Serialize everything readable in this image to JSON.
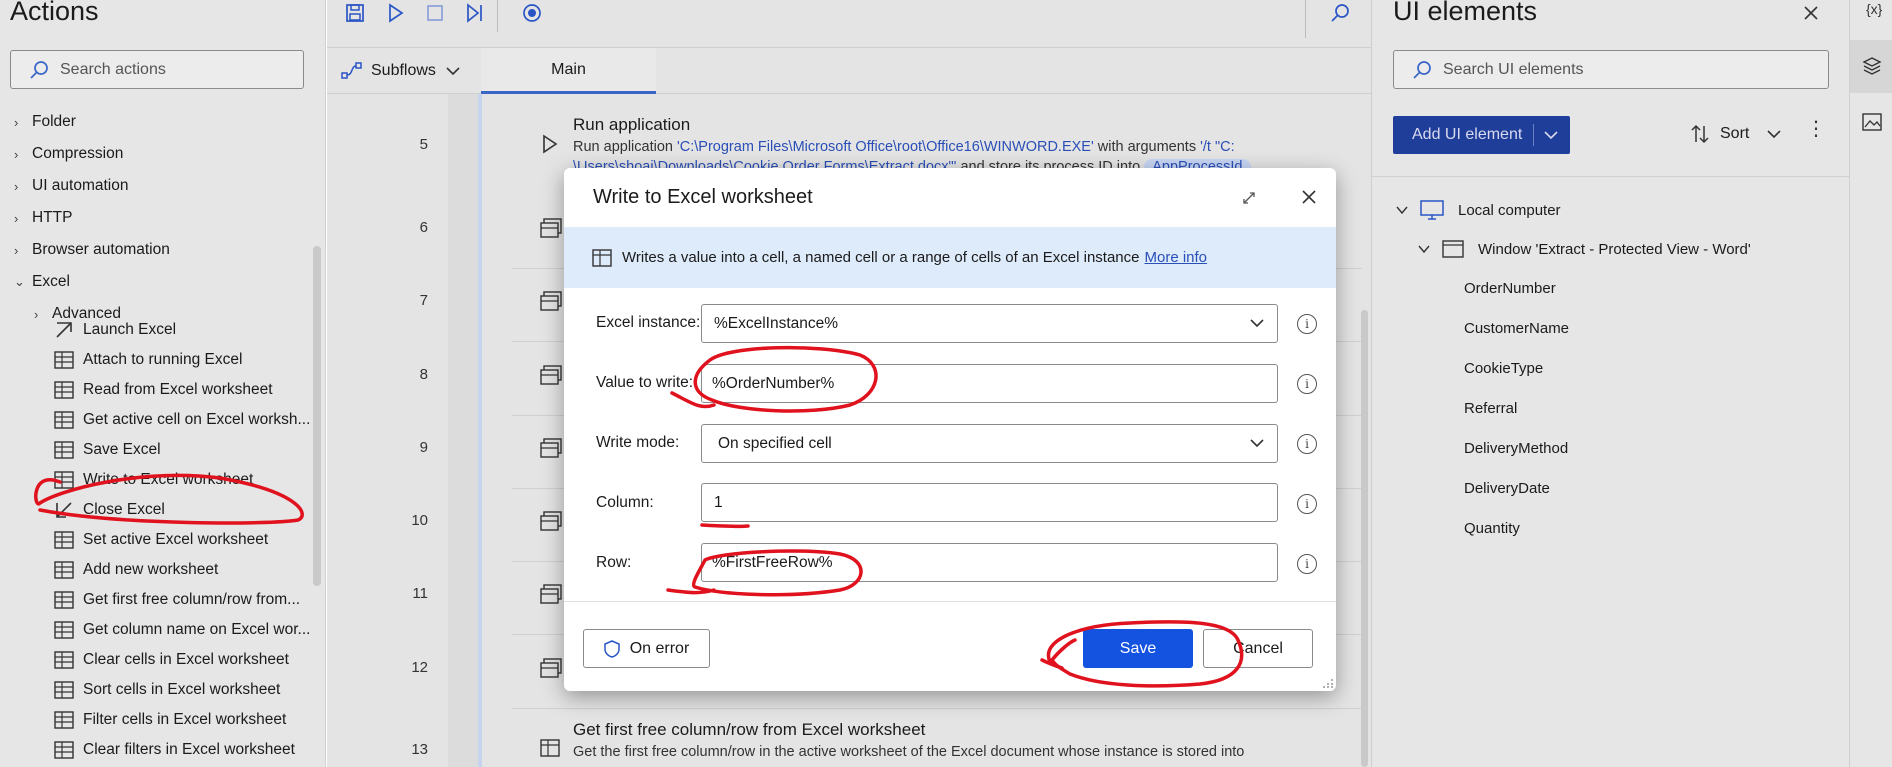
{
  "actions": {
    "title": "Actions",
    "search_placeholder": "Search actions",
    "categories": [
      {
        "label": "Folder"
      },
      {
        "label": "Compression"
      },
      {
        "label": "UI automation"
      },
      {
        "label": "HTTP"
      },
      {
        "label": "Browser automation"
      },
      {
        "label": "Excel"
      }
    ],
    "advanced_label": "Advanced",
    "items": [
      {
        "label": "Launch Excel",
        "icon": "launch-icon"
      },
      {
        "label": "Attach to running Excel",
        "icon": "excel-sheet-icon"
      },
      {
        "label": "Read from Excel worksheet",
        "icon": "excel-sheet-icon"
      },
      {
        "label": "Get active cell on Excel worksh...",
        "icon": "excel-sheet-icon"
      },
      {
        "label": "Save Excel",
        "icon": "excel-sheet-icon"
      },
      {
        "label": "Write to Excel worksheet",
        "icon": "excel-sheet-icon"
      },
      {
        "label": "Close Excel",
        "icon": "close-arrow-icon"
      },
      {
        "label": "Set active Excel worksheet",
        "icon": "excel-sheet-icon"
      },
      {
        "label": "Add new worksheet",
        "icon": "excel-sheet-icon"
      },
      {
        "label": "Get first free column/row from...",
        "icon": "excel-sheet-icon"
      },
      {
        "label": "Get column name on Excel wor...",
        "icon": "excel-sheet-icon"
      },
      {
        "label": "Clear cells in Excel worksheet",
        "icon": "excel-sheet-icon"
      },
      {
        "label": "Sort cells in Excel worksheet",
        "icon": "excel-sheet-icon"
      },
      {
        "label": "Filter cells in Excel worksheet",
        "icon": "excel-sheet-icon"
      },
      {
        "label": "Clear filters in Excel worksheet",
        "icon": "excel-sheet-icon"
      }
    ]
  },
  "designer": {
    "subflows_label": "Subflows",
    "main_tab": "Main",
    "line_numbers": [
      "5",
      "6",
      "7",
      "8",
      "9",
      "10",
      "11",
      "12",
      "13"
    ],
    "step_run_app": {
      "title": "Run application",
      "desc_prefix": "Run application ",
      "desc_path": "'C:\\Program Files\\Microsoft Office\\root\\Office16\\WINWORD.EXE'",
      "desc_mid": " with arguments ",
      "desc_args": "'/t \"C:",
      "desc_line2": "\\Users\\shoai\\Downloads\\Cookie Order Forms\\Extract.docx\"'",
      "desc_end": " and store its process ID into ",
      "desc_var": "AppProcessId"
    },
    "step_get_free": {
      "title": "Get first free column/row from Excel worksheet",
      "desc": "Get the first free column/row in the active worksheet of the Excel document whose instance is stored into"
    }
  },
  "ui_elements": {
    "title": "UI elements",
    "search_placeholder": "Search UI elements",
    "add_label": "Add UI element",
    "sort_label": "Sort",
    "local_computer": "Local computer",
    "window_label": "Window 'Extract - Protected View - Word'",
    "elements": [
      "OrderNumber",
      "CustomerName",
      "CookieType",
      "Referral",
      "DeliveryMethod",
      "DeliveryDate",
      "Quantity"
    ],
    "var_label": "{x}"
  },
  "dialog": {
    "title": "Write to Excel worksheet",
    "info_text": "Writes a value into a cell, a named cell or a range of cells of an Excel instance",
    "more_info": "More info",
    "fields": {
      "excel_instance": {
        "label": "Excel instance:",
        "value": "%ExcelInstance%"
      },
      "value_to_write": {
        "label": "Value to write:",
        "value": "%OrderNumber%"
      },
      "write_mode": {
        "label": "Write mode:",
        "value": "On specified cell"
      },
      "column": {
        "label": "Column:",
        "value": "1"
      },
      "row": {
        "label": "Row:",
        "value": "%FirstFreeRow%"
      }
    },
    "on_error": "On error",
    "save": "Save",
    "cancel": "Cancel"
  },
  "colors": {
    "accent": "#1452e0",
    "annotation": "#e0121e",
    "info_bar": "#deebfb"
  }
}
